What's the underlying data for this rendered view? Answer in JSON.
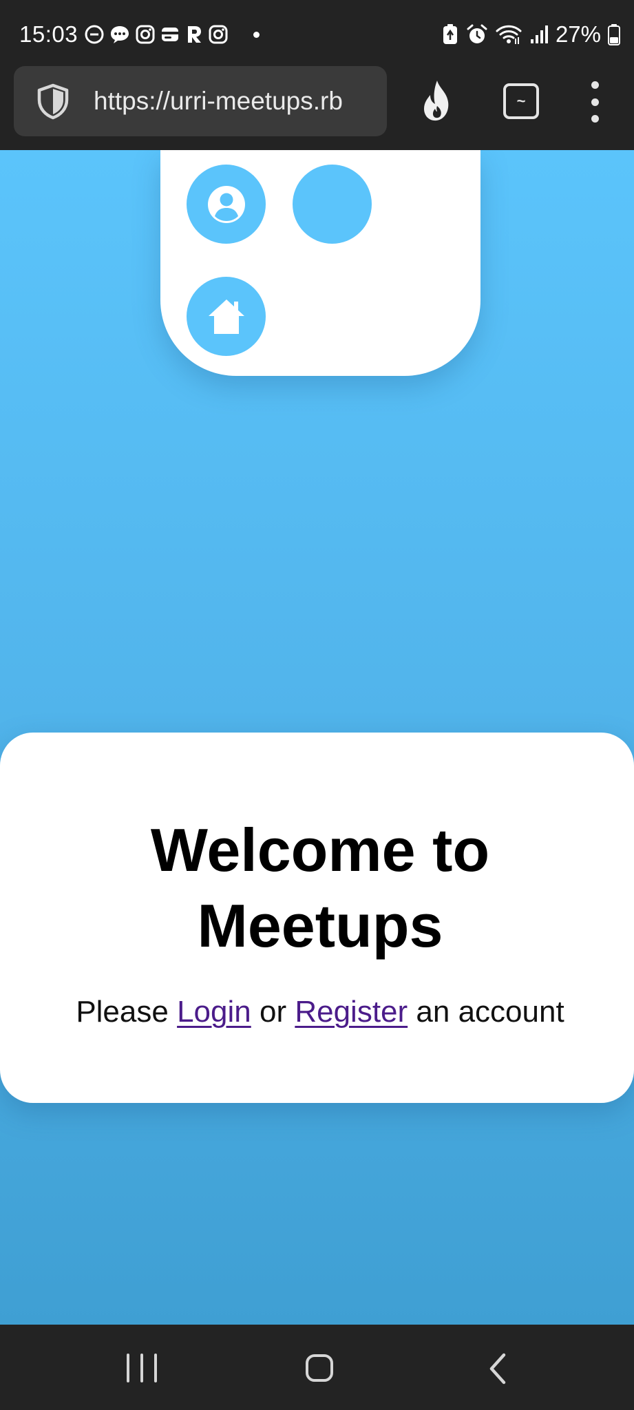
{
  "status_bar": {
    "time": "15:03",
    "battery_percent": "27%",
    "left_icons": [
      "do-not-disturb-icon",
      "messages-icon",
      "instagram-icon",
      "wallet-icon",
      "r-app-icon",
      "instagram-icon",
      "notification-dot-icon"
    ],
    "right_icons": [
      "battery-saver-icon",
      "alarm-icon",
      "wifi-icon",
      "signal-icon",
      "battery-icon"
    ]
  },
  "browser": {
    "url": "https://urri-meetups.rb",
    "tab_button_glyph": "~",
    "icons": [
      "shield-icon",
      "fire-icon",
      "tabs-icon",
      "more-vert-icon"
    ]
  },
  "nav_card": {
    "icons": [
      "profile-icon",
      "blank-icon",
      "home-icon"
    ]
  },
  "welcome": {
    "title": "Welcome to Meetups",
    "text_before": "Please ",
    "login_link": "Login",
    "text_middle": " or ",
    "register_link": "Register",
    "text_after": " an account"
  },
  "colors": {
    "accent_blue": "#5bc4fb",
    "link_purple": "#4b1c8a",
    "system_bar": "#232323",
    "card_white": "#ffffff"
  },
  "android_nav": {
    "icons": [
      "recents-icon",
      "home-icon",
      "back-icon"
    ]
  }
}
